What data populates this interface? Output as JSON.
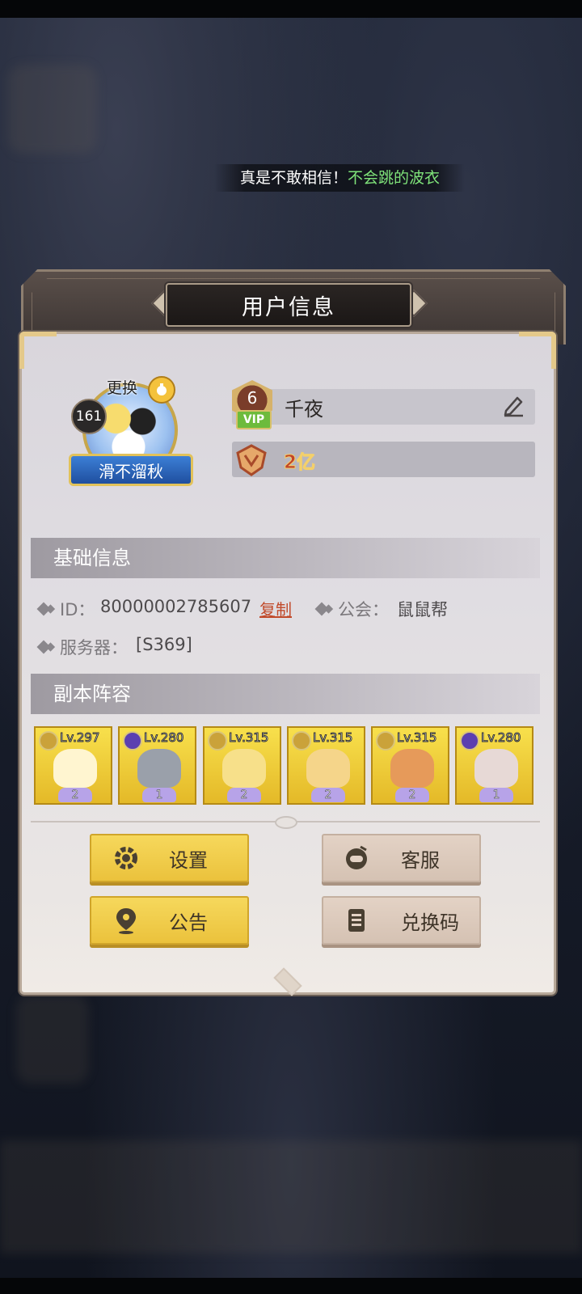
{
  "ticker": {
    "part1": "真是不敢相信！",
    "part2": "不会跳的波衣"
  },
  "dialog": {
    "title": "用户信息",
    "avatar": {
      "level": "161",
      "change_label": "更换",
      "frame_name": "滑不溜秋"
    },
    "vip_level": "6",
    "vip_label": "VIP",
    "player_name": "千夜",
    "power": "2亿"
  },
  "basic_info": {
    "title": "基础信息",
    "id_label": "ID：",
    "id_value": "80000002785607",
    "copy_label": "复制",
    "guild_label": "公会：",
    "guild_value": "鼠鼠帮",
    "server_label": "服务器：",
    "server_value": "[S369]"
  },
  "lineup": {
    "title": "副本阵容",
    "heroes": [
      {
        "level": "Lv.297",
        "stars": "2",
        "class_color": "#caa23a",
        "face": "#fff5d0"
      },
      {
        "level": "Lv.280",
        "stars": "1",
        "class_color": "#5b3fb0",
        "face": "#9aa0aa"
      },
      {
        "level": "Lv.315",
        "stars": "2",
        "class_color": "#caa23a",
        "face": "#f7e08a"
      },
      {
        "level": "Lv.315",
        "stars": "2",
        "class_color": "#caa23a",
        "face": "#f5d58a"
      },
      {
        "level": "Lv.315",
        "stars": "2",
        "class_color": "#caa23a",
        "face": "#e69a5a"
      },
      {
        "level": "Lv.280",
        "stars": "1",
        "class_color": "#5b3fb0",
        "face": "#e7d9d6"
      }
    ]
  },
  "buttons": {
    "settings": "设置",
    "support": "客服",
    "notice": "公告",
    "redeem": "兑换码"
  },
  "colors": {
    "gold_button": "#ebc23c",
    "tan_button": "#d5c2b3",
    "power_text": "#c1442a",
    "ticker_highlight": "#7fe37a"
  }
}
